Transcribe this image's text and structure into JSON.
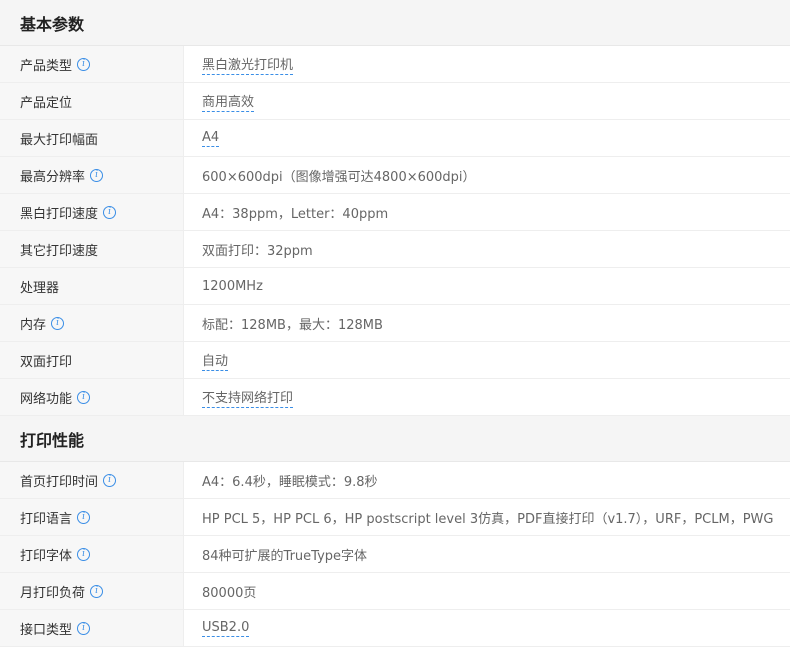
{
  "sections": [
    {
      "title": "基本参数",
      "rows": [
        {
          "label": "产品类型",
          "info": true,
          "value": "黑白激光打印机",
          "link": true
        },
        {
          "label": "产品定位",
          "info": false,
          "value": "商用高效",
          "link": true
        },
        {
          "label": "最大打印幅面",
          "info": false,
          "value": "A4",
          "link": true
        },
        {
          "label": "最高分辨率",
          "info": true,
          "value": "600×600dpi（图像增强可达4800×600dpi）",
          "link": false
        },
        {
          "label": "黑白打印速度",
          "info": true,
          "value": "A4：38ppm，Letter：40ppm",
          "link": false
        },
        {
          "label": "其它打印速度",
          "info": false,
          "value": "双面打印：32ppm",
          "link": false
        },
        {
          "label": "处理器",
          "info": false,
          "value": "1200MHz",
          "link": false
        },
        {
          "label": "内存",
          "info": true,
          "value": "标配：128MB，最大：128MB",
          "link": false
        },
        {
          "label": "双面打印",
          "info": false,
          "value": "自动",
          "link": true
        },
        {
          "label": "网络功能",
          "info": true,
          "value": "不支持网络打印",
          "link": true
        }
      ]
    },
    {
      "title": "打印性能",
      "rows": [
        {
          "label": "首页打印时间",
          "info": true,
          "value": "A4：6.4秒，睡眠模式：9.8秒",
          "link": false
        },
        {
          "label": "打印语言",
          "info": true,
          "value": "HP PCL 5，HP PCL 6，HP postscript level 3仿真，PDF直接打印（v1.7），URF，PCLM，PWG",
          "link": false
        },
        {
          "label": "打印字体",
          "info": true,
          "value": "84种可扩展的TrueType字体",
          "link": false
        },
        {
          "label": "月打印负荷",
          "info": true,
          "value": "80000页",
          "link": false
        },
        {
          "label": "接口类型",
          "info": true,
          "value": "USB2.0",
          "link": true
        }
      ]
    }
  ],
  "icons": {
    "info": "info-icon"
  },
  "colors": {
    "accent": "#3a8ee6",
    "label_bg": "#f7f7f7",
    "header_bg": "#f5f5f5"
  }
}
